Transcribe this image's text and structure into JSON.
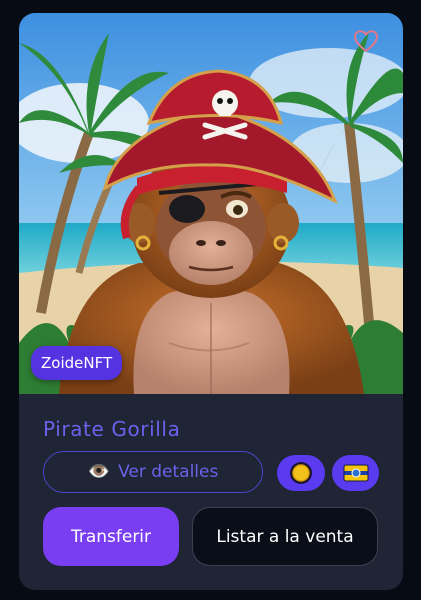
{
  "nft": {
    "title": "Pirate Gorilla",
    "creator_badge": "ZoideNFT",
    "image_subject": "cartoon pirate gorilla on tropical beach"
  },
  "actions": {
    "details_label": "Ver detalles",
    "details_icon": "👁️",
    "transfer_label": "Transferir",
    "list_for_sale_label": "Listar a la venta"
  },
  "chips": {
    "coin_icon": "coin-icon",
    "flag_icon": "flag-icon"
  },
  "colors": {
    "accent": "#6a62ec",
    "primary_button": "#7a3ef2",
    "badge": "#5533e0",
    "card_bg": "#1f2534",
    "page_bg": "#070b14"
  }
}
